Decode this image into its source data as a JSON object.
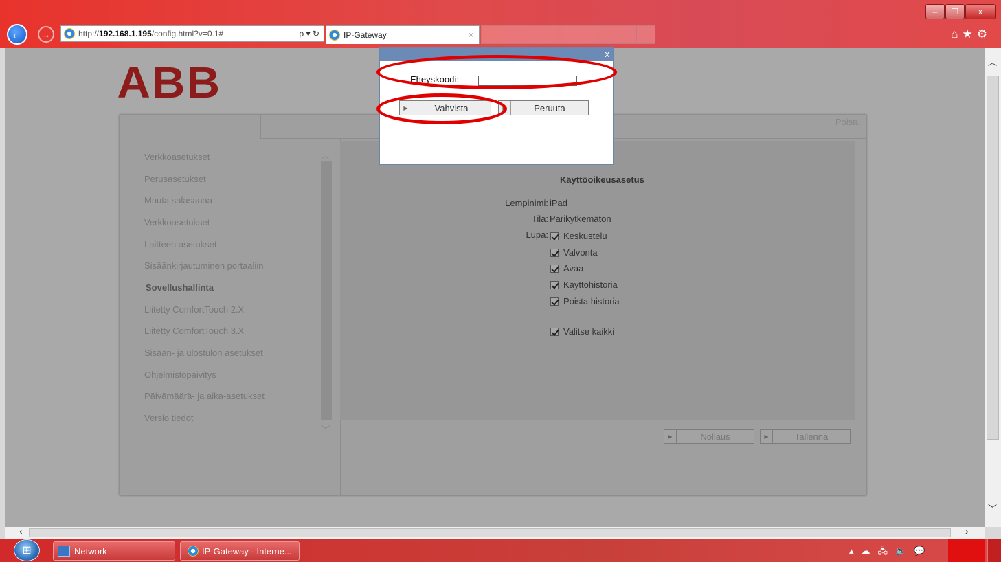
{
  "browser": {
    "url_prefix": "http://",
    "url_host": "192.168.1.195",
    "url_path": "/config.html?v=0.1#",
    "address_tools": "ρ ▾ ↻",
    "tab_title": "IP-Gateway",
    "tab_close": "×",
    "window_controls": {
      "minimize": "–",
      "restore": "❐",
      "close": "x"
    },
    "tool_icons": "⌂★⚙"
  },
  "page": {
    "logo_text": "ABB",
    "logout_label": "Poistu",
    "nav": [
      "Verkkoasetukset",
      "Perusasetukset",
      "Muuta salasanaa",
      "Verkkoasetukset",
      "Laitteen asetukset",
      "Sisäänkirjautuminen portaaliin",
      "Sovellushallinta",
      "Liitetty ComfortTouch 2.X",
      "Liitetty ComfortTouch 3.X",
      "Sisään- ja ulostulon asetukset",
      "Ohjelmistopäivitys",
      "Päivämäärä- ja aika-asetukset",
      "Versio tiedot"
    ],
    "nav_active_index": 6,
    "content": {
      "title": "Käyttöoikeusasetus",
      "nickname_label": "Lempinimi:",
      "nickname_value": "iPad",
      "state_label": "Tila:",
      "state_value": "Parikytkemätön",
      "permission_label": "Lupa:",
      "permissions": [
        "Keskustelu",
        "Valvonta",
        "Avaa",
        "Käyttöhistoria",
        "Poista historia"
      ],
      "permissions_checked": [
        true,
        true,
        true,
        true,
        true
      ],
      "select_all_label": "Valitse kaikki",
      "select_all_checked": true
    },
    "buttons": {
      "reset": "Nollaus",
      "save": "Tallenna"
    }
  },
  "modal": {
    "close_label": "x",
    "code_label": "Eheyskoodi:",
    "code_value": "",
    "confirm_label": "Vahvista",
    "cancel_label": "Peruuta"
  },
  "taskbar": {
    "items": [
      "Network",
      "IP-Gateway - Interne..."
    ],
    "tray_icons": "▴☁🖧🔈💬"
  },
  "colors": {
    "titlebar": "#e8332c",
    "modal_header": "#6b8ab5",
    "highlight": "#e00000",
    "logo": "#8c1c1c"
  }
}
